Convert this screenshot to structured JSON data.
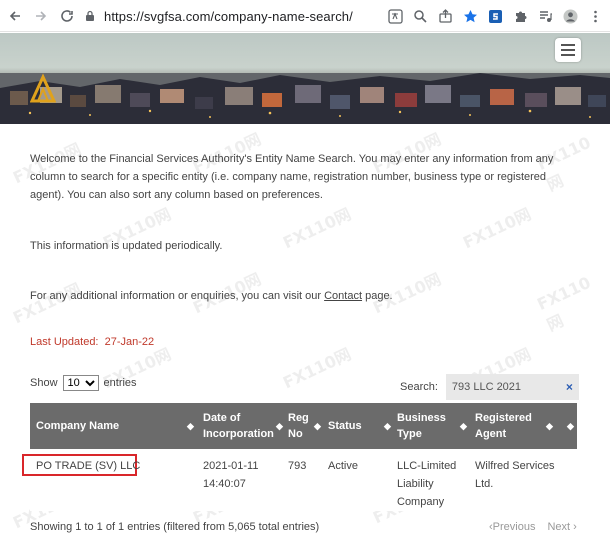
{
  "browser": {
    "url": "https://svgfsa.com/company-name-search/"
  },
  "intro": {
    "text": "Welcome to the Financial Services Authority's Entity Name Search. You may enter any information from any column to search for a specific entity (i.e. company name, registration number, business type or registered agent). You can also sort any column based on preferences.",
    "periodic": "This information is updated periodically.",
    "contact_prefix": "For any additional information or enquiries, you can visit our ",
    "contact_link": "Contact",
    "contact_suffix": " page."
  },
  "updated": {
    "label": "Last Updated:",
    "value": "27-Jan-22"
  },
  "controls": {
    "show_label": "Show",
    "entries_value": "10",
    "entries_label": "entries",
    "search_label": "Search:",
    "search_value": "793 LLC 2021",
    "clear": "×"
  },
  "table": {
    "columns": [
      {
        "label": "Company Name"
      },
      {
        "label": "Date of Incorporation"
      },
      {
        "label": "Reg No"
      },
      {
        "label": "Status"
      },
      {
        "label": "Business Type"
      },
      {
        "label": "Registered Agent"
      }
    ],
    "rows": [
      {
        "company": "PO TRADE (SV) LLC",
        "date": "2021-01-11 14:40:07",
        "reg_no": "793",
        "status": "Active",
        "business_type": "LLC-Limited Liability Company",
        "agent": "Wilfred Services Ltd."
      }
    ]
  },
  "footer": {
    "info": "Showing 1 to 1 of 1 entries (filtered from 5,065 total entries)",
    "previous": "Previous",
    "next": "Next"
  },
  "watermark": "FX110网",
  "colors": {
    "header_bg": "#6b6b6b",
    "updated_red": "#c0392b",
    "highlight_red": "#d9262a",
    "link_blue": "#2b5db3"
  }
}
